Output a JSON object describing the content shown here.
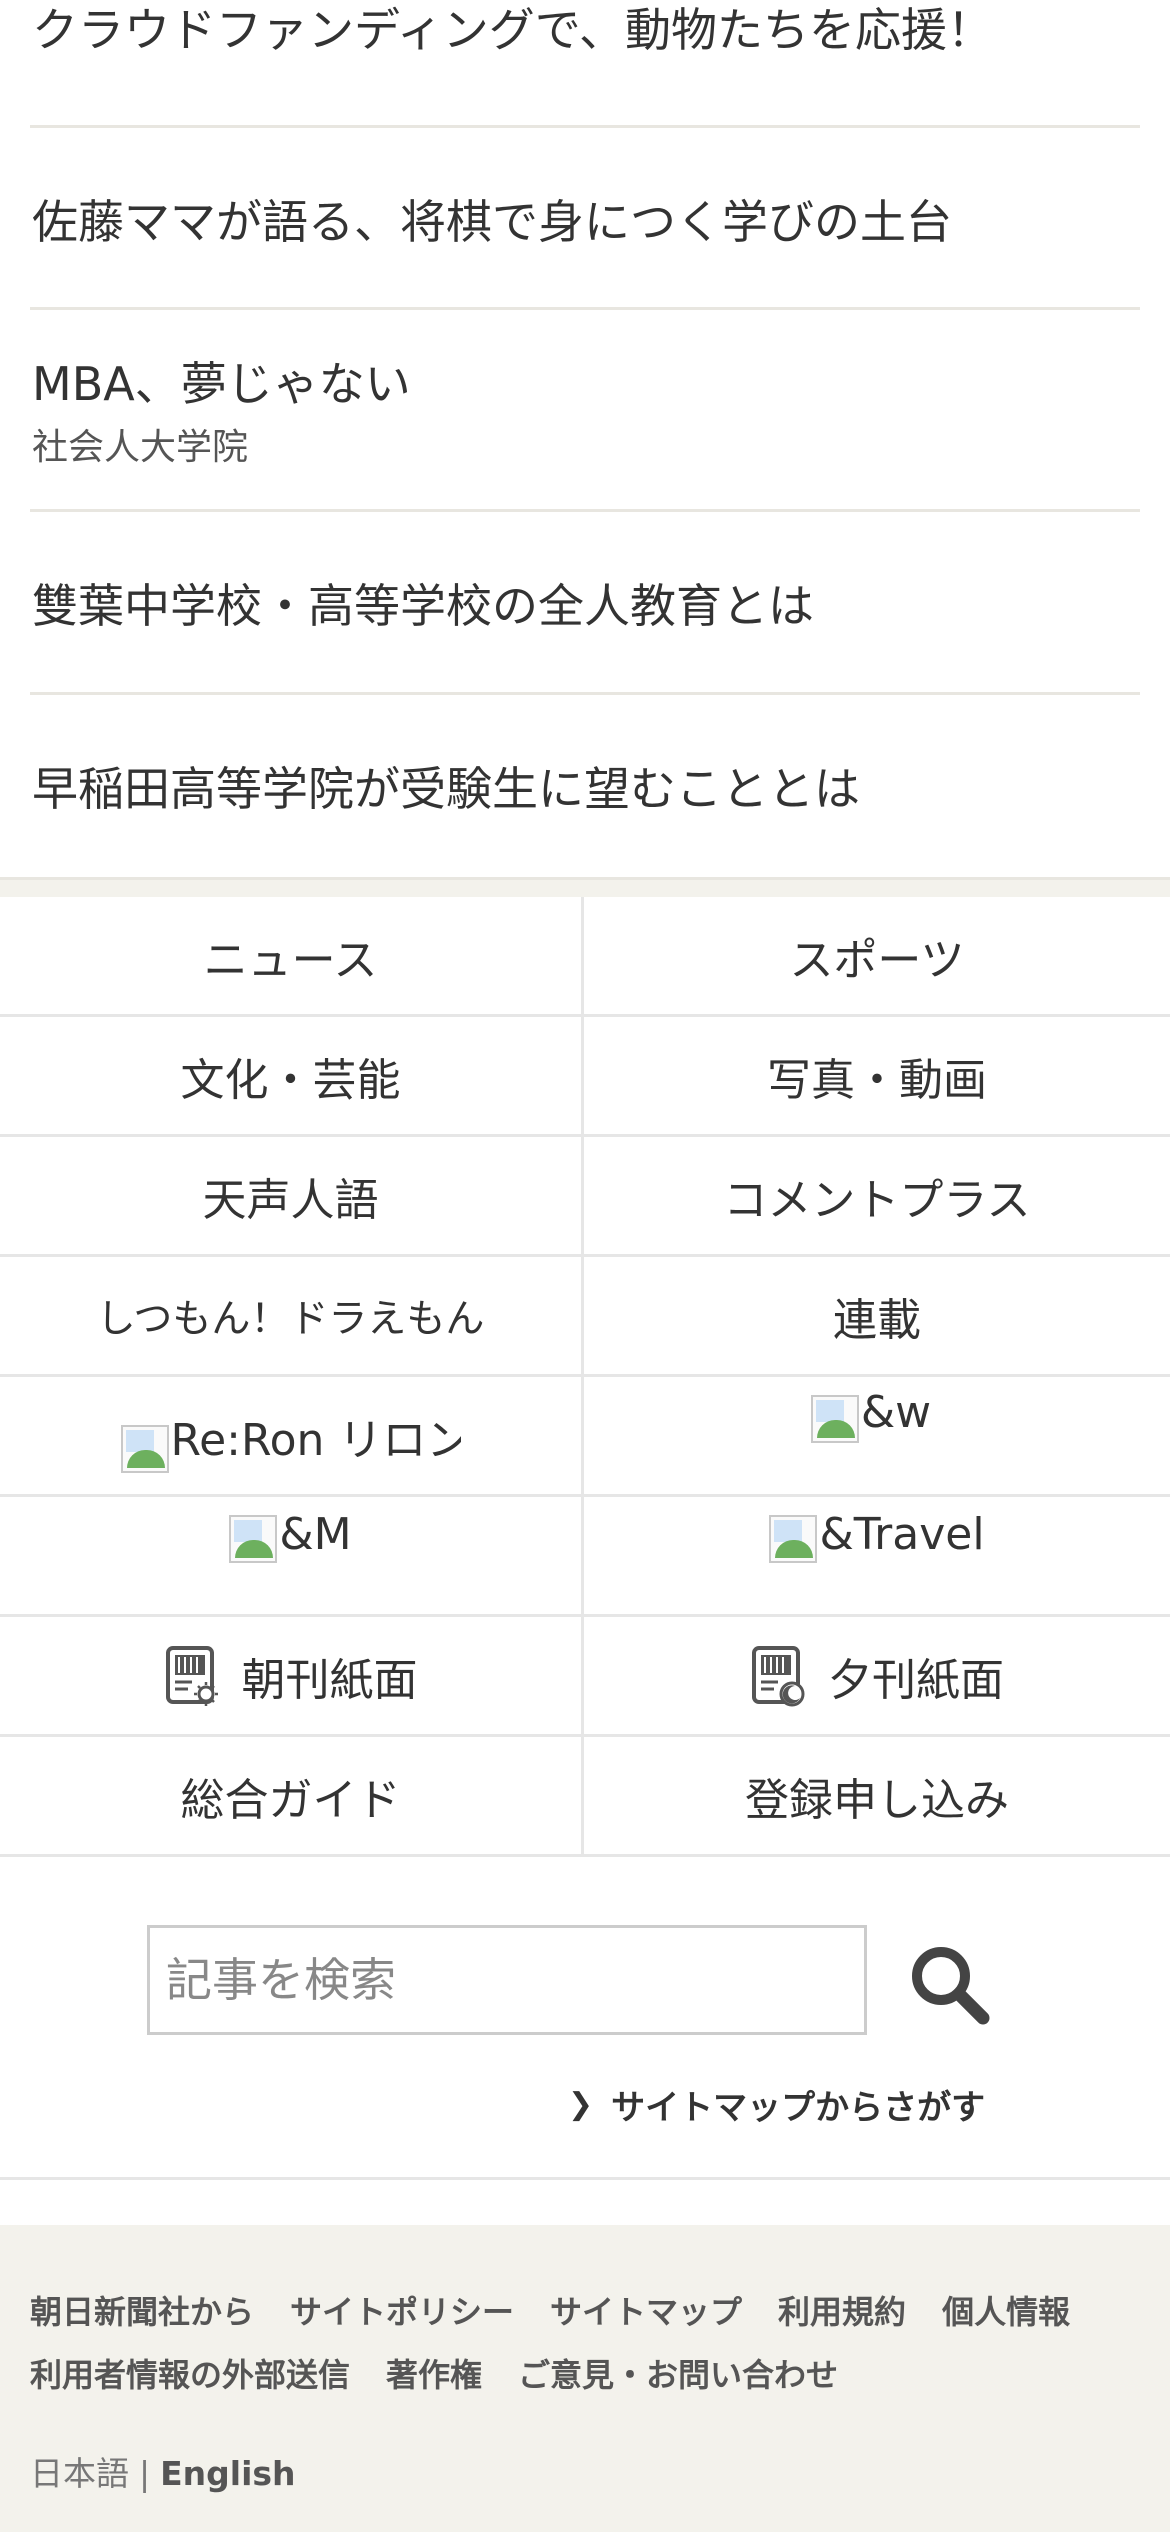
{
  "articles": [
    {
      "title": "クラウドファンディングで、動物たちを応援！"
    },
    {
      "title": "佐藤ママが語る、将棋で身につく学びの土台"
    },
    {
      "title": "MBA、夢じゃない",
      "subtitle": "社会人大学院"
    },
    {
      "title": "雙葉中学校・高等学校の全人教育とは"
    },
    {
      "title": "早稲田高等学院が受験生に望むこととは"
    }
  ],
  "nav": [
    {
      "label": "ニュース"
    },
    {
      "label": "スポーツ"
    },
    {
      "label": "文化・芸能"
    },
    {
      "label": "写真・動画"
    },
    {
      "label": "天声人語"
    },
    {
      "label": "コメントプラス"
    },
    {
      "label": "しつもん！ドラえもん"
    },
    {
      "label": "連載"
    },
    {
      "label": "Re:Ron リロン"
    },
    {
      "label": "&w"
    },
    {
      "label": "&M"
    },
    {
      "label": "&Travel"
    },
    {
      "label": "朝刊紙面",
      "icon": "morning-paper-icon"
    },
    {
      "label": "夕刊紙面",
      "icon": "evening-paper-icon"
    },
    {
      "label": "総合ガイド"
    },
    {
      "label": "登録申し込み"
    }
  ],
  "search": {
    "placeholder": "記事を検索",
    "icon": "search-icon",
    "sitemap_link": "サイトマップからさがす"
  },
  "footer": {
    "links_row1": [
      "朝日新聞社から",
      "サイトポリシー",
      "サイトマップ",
      "利用規約",
      "個人情報"
    ],
    "links_row2": [
      "利用者情報の外部送信",
      "著作権",
      "ご意見・お問い合わせ"
    ],
    "lang_ja": "日本語",
    "lang_sep": "|",
    "lang_en": "English"
  },
  "colors": {
    "text": "#333333",
    "footer_bg": "#f3f2ec",
    "divider": "#e6e6e6"
  }
}
